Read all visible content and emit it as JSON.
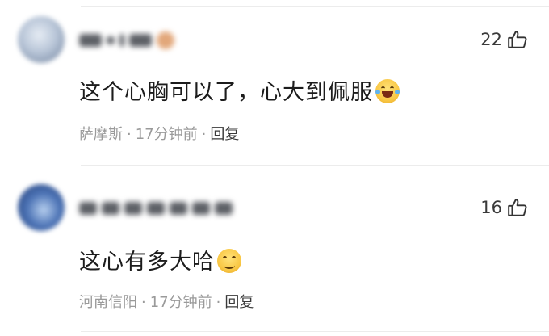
{
  "comments": [
    {
      "username": "用户1",
      "text": "这个心胸可以了，心大到佩服",
      "emoji": "laughing-tears-emoji",
      "location": "萨摩斯",
      "time": "17分钟前",
      "reply_label": "回复",
      "likes": "22"
    },
    {
      "username": "用户2",
      "text": "这心有多大哈",
      "emoji": "smiling-emoji",
      "location": "河南信阳",
      "time": "17分钟前",
      "reply_label": "回复",
      "likes": "16"
    }
  ],
  "separator": "·",
  "icons": {
    "like": "thumbs-up-icon"
  }
}
